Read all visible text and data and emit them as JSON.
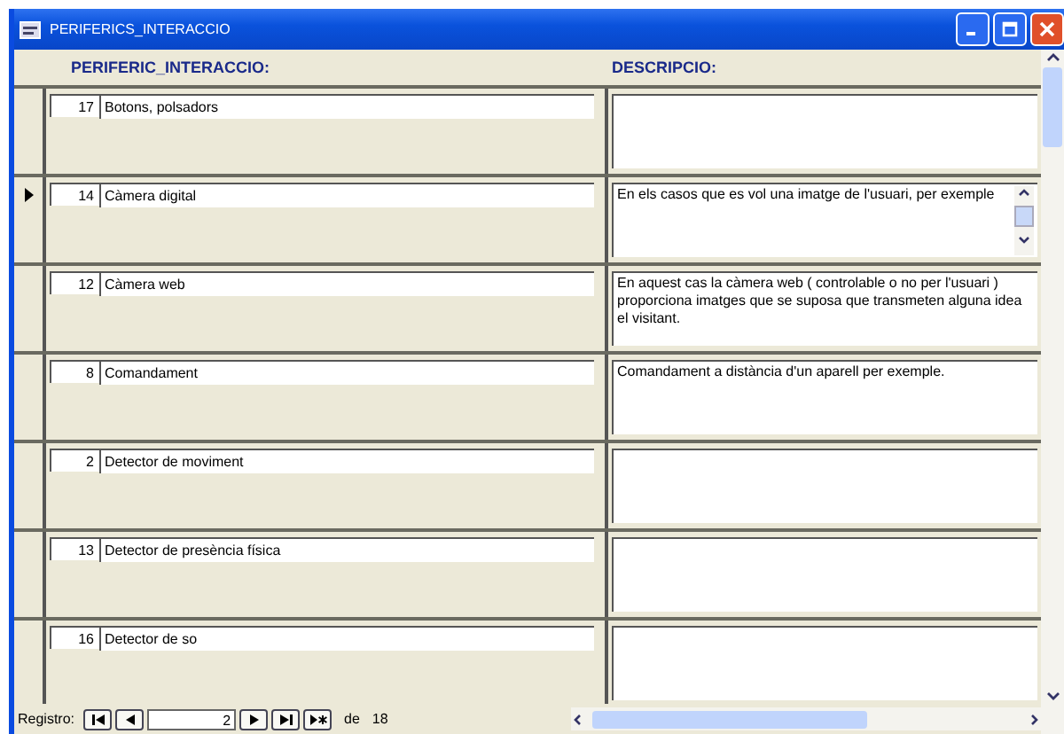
{
  "window": {
    "title": "PERIFERICS_INTERACCIO"
  },
  "columns": [
    "PERIFERIC_INTERACCIO:",
    "DESCRIPCIO:"
  ],
  "records": [
    {
      "id": "17",
      "name": "Botons, polsadors",
      "selected": false
    },
    {
      "id": "14",
      "name": "Càmera digital",
      "description": "En els casos que es vol una imatge de l'usuari, per exemple",
      "selected": true
    },
    {
      "id": "12",
      "name": "Càmera web",
      "description": "En aquest cas la càmera web ( controlable o no per l'usuari ) proporciona imatges que se suposa que transmeten alguna idea el visitant.",
      "selected": false
    },
    {
      "id": "8",
      "name": "Comandament",
      "description": "Comandament a distància d'un aparell per exemple.",
      "selected": false
    },
    {
      "id": "2",
      "name": "Detector de moviment",
      "selected": false
    },
    {
      "id": "13",
      "name": "Detector de presència física",
      "selected": false
    },
    {
      "id": "16",
      "name": "Detector de so",
      "selected": false
    }
  ],
  "navigator": {
    "label": "Registro:",
    "current": "2",
    "of": "de",
    "total": "18"
  }
}
